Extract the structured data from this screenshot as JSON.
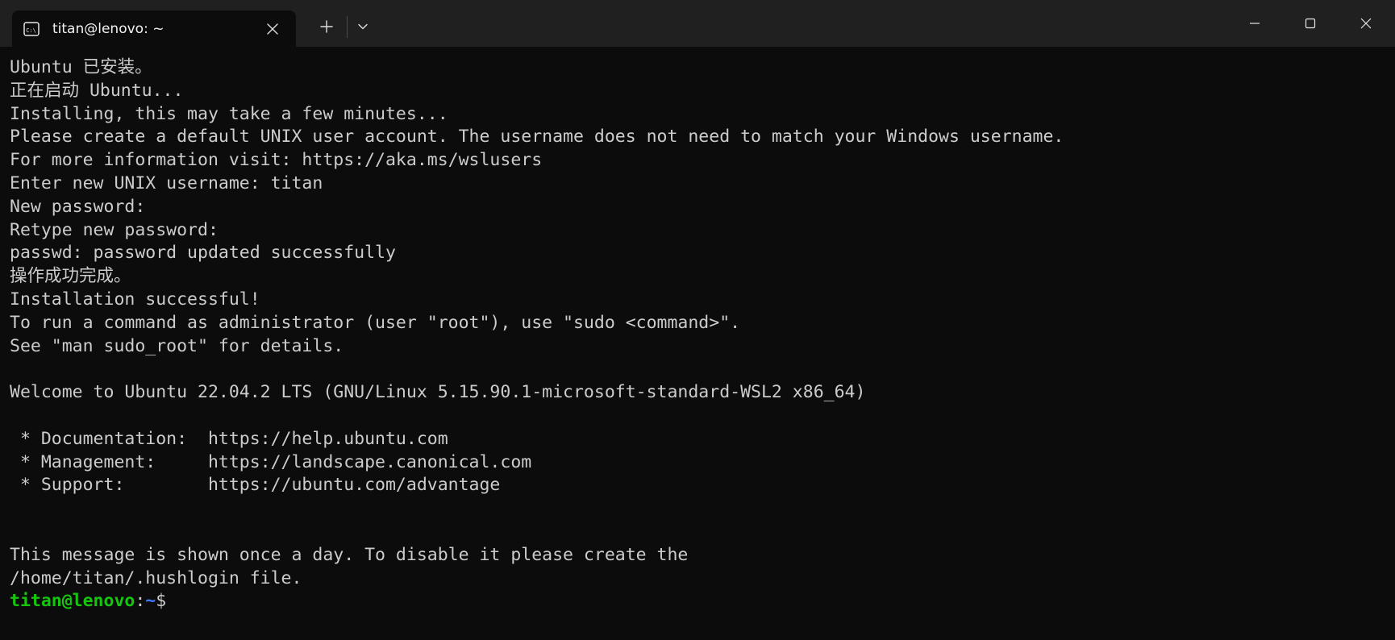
{
  "tab": {
    "icon": "terminal-icon",
    "title": "titan@lenovo: ~"
  },
  "titlebar": {
    "new_tab_icon": "plus-icon",
    "dropdown_icon": "chevron-down-icon"
  },
  "terminal": {
    "lines": [
      "Ubuntu 已安装。",
      "正在启动 Ubuntu...",
      "Installing, this may take a few minutes...",
      "Please create a default UNIX user account. The username does not need to match your Windows username.",
      "For more information visit: https://aka.ms/wslusers",
      "Enter new UNIX username: titan",
      "New password:",
      "Retype new password:",
      "passwd: password updated successfully",
      "操作成功完成。",
      "Installation successful!",
      "To run a command as administrator (user \"root\"), use \"sudo <command>\".",
      "See \"man sudo_root\" for details.",
      "",
      "Welcome to Ubuntu 22.04.2 LTS (GNU/Linux 5.15.90.1-microsoft-standard-WSL2 x86_64)",
      "",
      " * Documentation:  https://help.ubuntu.com",
      " * Management:     https://landscape.canonical.com",
      " * Support:        https://ubuntu.com/advantage",
      "",
      "",
      "This message is shown once a day. To disable it please create the",
      "/home/titan/.hushlogin file."
    ],
    "prompt": {
      "user_host": "titan@lenovo",
      "colon": ":",
      "path": "~",
      "symbol": "$"
    }
  },
  "colors": {
    "background": "#0c0c0c",
    "titlebar": "#202020",
    "text": "#cccccc",
    "prompt_user": "#16c60c",
    "prompt_path": "#3b78ff"
  }
}
